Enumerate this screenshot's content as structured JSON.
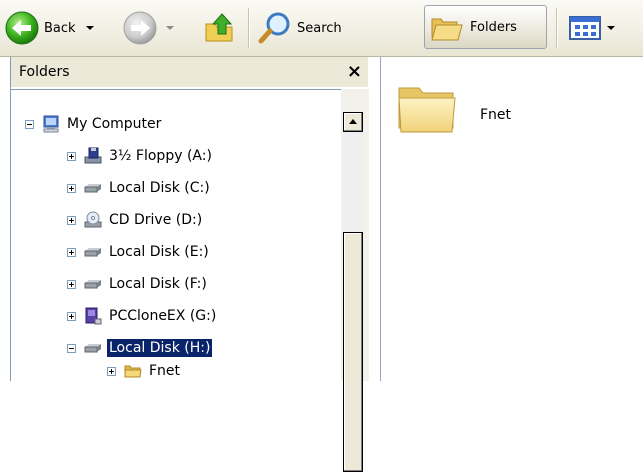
{
  "toolbar": {
    "back_label": "Back",
    "search_label": "Search",
    "folders_label": "Folders"
  },
  "folders_pane": {
    "title": "Folders",
    "close_glyph": "×"
  },
  "tree": {
    "items": [
      {
        "label": "My Computer",
        "icon": "computer-icon",
        "expander": "minus"
      },
      {
        "label": "3½ Floppy (A:)",
        "icon": "floppy-drive-icon",
        "expander": "plus"
      },
      {
        "label": "Local Disk (C:)",
        "icon": "hard-disk-icon",
        "expander": "plus"
      },
      {
        "label": "CD Drive (D:)",
        "icon": "cd-drive-icon",
        "expander": "plus"
      },
      {
        "label": "Local Disk (E:)",
        "icon": "hard-disk-icon",
        "expander": "plus"
      },
      {
        "label": "Local Disk (F:)",
        "icon": "hard-disk-icon",
        "expander": "plus"
      },
      {
        "label": "PCCloneEX (G:)",
        "icon": "removable-drive-icon",
        "expander": "plus"
      },
      {
        "label": "Local Disk (H:)",
        "icon": "hard-disk-icon",
        "expander": "minus",
        "selected": true
      },
      {
        "label": "Fnet",
        "icon": "folder-icon",
        "expander": "plus"
      }
    ]
  },
  "content": {
    "folder_name": "Fnet"
  },
  "colors": {
    "selection": "#0a246a",
    "pane_header": "#ece9d8"
  }
}
